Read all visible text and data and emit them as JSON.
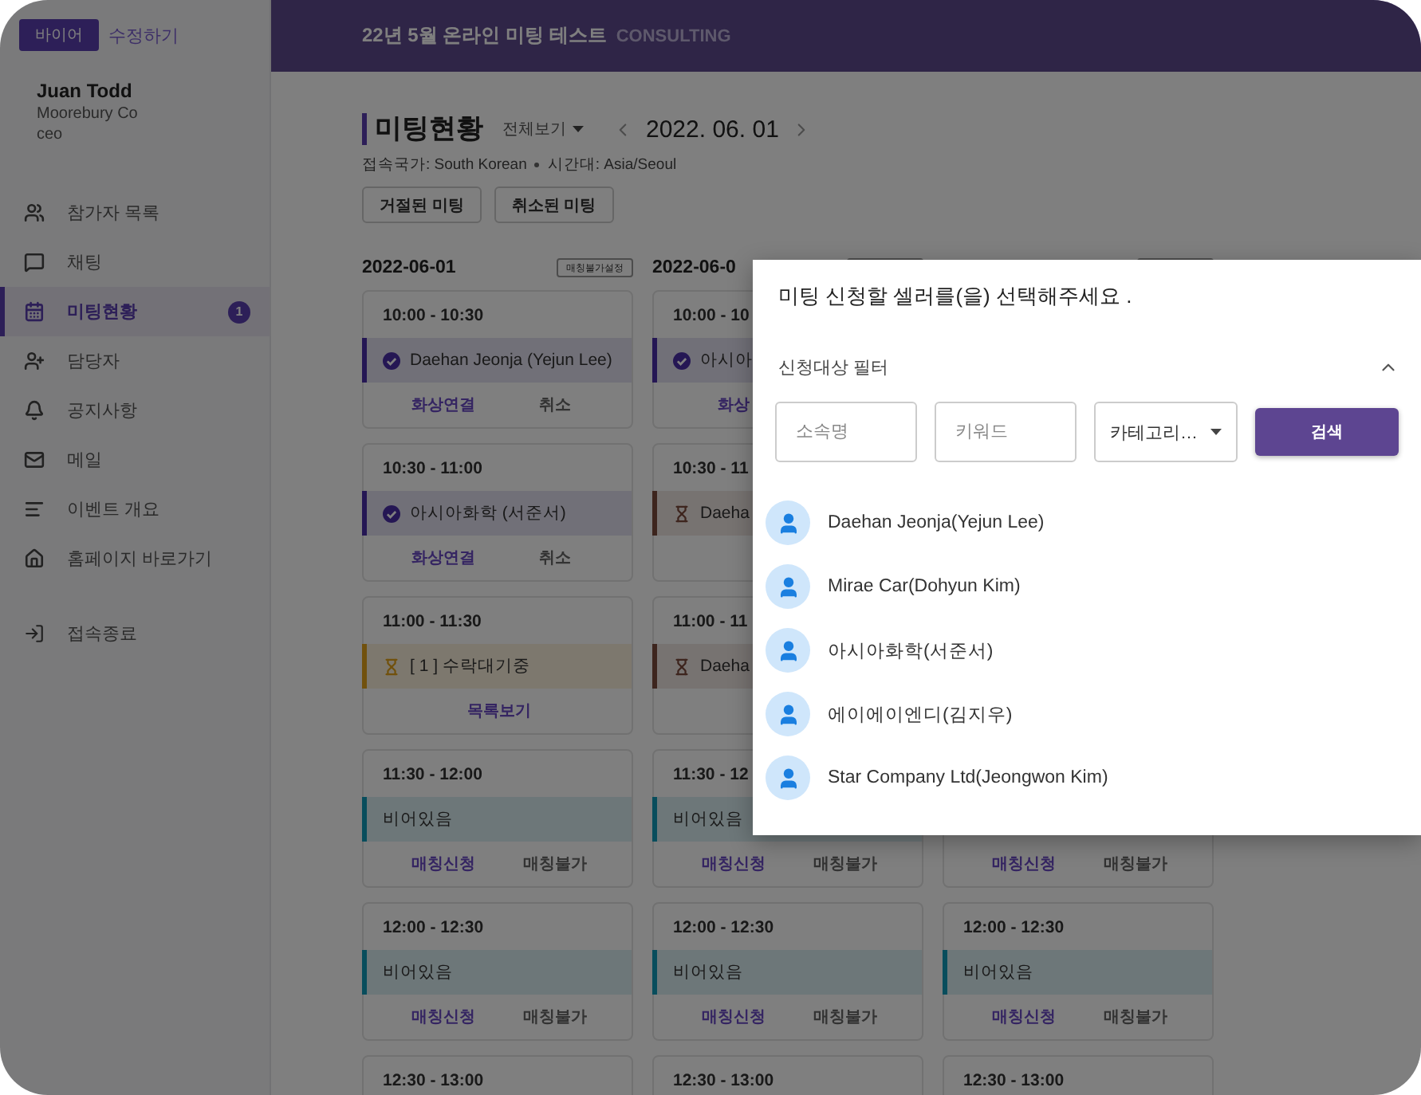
{
  "sidebar": {
    "role_badge": "바이어",
    "edit_link": "수정하기",
    "user": {
      "name": "Juan Todd",
      "company": "Moorebury Co",
      "position": "ceo"
    },
    "items": [
      {
        "label": "참가자 목록",
        "selected": false
      },
      {
        "label": "채팅",
        "selected": false
      },
      {
        "label": "미팅현황",
        "selected": true,
        "badge": "1"
      },
      {
        "label": "담당자",
        "selected": false
      },
      {
        "label": "공지사항",
        "selected": false
      },
      {
        "label": "메일",
        "selected": false
      },
      {
        "label": "이벤트 개요",
        "selected": false
      },
      {
        "label": "홈페이지 바로가기",
        "selected": false
      }
    ],
    "logout": "접속종료"
  },
  "header": {
    "title": "22년 5월 온라인 미팅 테스트",
    "subtitle": "CONSULTING"
  },
  "page": {
    "title": "미팅현황",
    "view_filter": "전체보기",
    "date": "2022. 06. 01",
    "country": "접속국가: South Korean",
    "timezone": "시간대: Asia/Seoul",
    "buttons": [
      "거절된 미팅",
      "취소된 미팅"
    ]
  },
  "columns": [
    {
      "date": "2022-06-01",
      "badge": "매칭불가설정",
      "slots": [
        {
          "time": "10:00 - 10:30",
          "kind": "confirmed",
          "label": "Daehan Jeonja (Yejun Lee)",
          "actions": [
            {
              "label": "화상연결",
              "kind": "primary"
            },
            {
              "label": "취소",
              "kind": "plain"
            }
          ]
        },
        {
          "time": "10:30 - 11:00",
          "kind": "confirmed",
          "label": "아시아화학 (서준서)",
          "actions": [
            {
              "label": "화상연결",
              "kind": "primary"
            },
            {
              "label": "취소",
              "kind": "plain"
            }
          ]
        },
        {
          "time": "11:00 - 11:30",
          "kind": "waiting",
          "label": "[ 1 ] 수락대기중",
          "actions": [
            {
              "label": "목록보기",
              "kind": "primary"
            }
          ]
        },
        {
          "time": "11:30 - 12:00",
          "kind": "empty",
          "label": "비어있음",
          "actions": [
            {
              "label": "매칭신청",
              "kind": "primary"
            },
            {
              "label": "매칭불가",
              "kind": "plain"
            }
          ]
        },
        {
          "time": "12:00 - 12:30",
          "kind": "empty",
          "label": "비어있음",
          "actions": [
            {
              "label": "매칭신청",
              "kind": "primary"
            },
            {
              "label": "매칭불가",
              "kind": "plain"
            }
          ]
        },
        {
          "time": "12:30 - 13:00",
          "kind": "empty"
        }
      ]
    },
    {
      "date": "2022-06-0",
      "slots": [
        {
          "time": "10:00 - 10",
          "kind": "confirmed",
          "label": "아시아",
          "actions": [
            {
              "label": "화상",
              "kind": "primary"
            }
          ]
        },
        {
          "time": "10:30 - 11",
          "kind": "requested",
          "label": "Daeha"
        },
        {
          "time": "11:00 - 11",
          "kind": "requested",
          "label": "Daeha"
        },
        {
          "time": "11:30 - 12",
          "kind": "empty",
          "label": "비어있음",
          "actions": [
            {
              "label": "매칭신청",
              "kind": "primary"
            },
            {
              "label": "매칭불가",
              "kind": "plain"
            }
          ]
        },
        {
          "time": "12:00 - 12:30",
          "kind": "empty",
          "label": "비어있음",
          "actions": [
            {
              "label": "매칭신청",
              "kind": "primary"
            },
            {
              "label": "매칭불가",
              "kind": "plain"
            }
          ]
        },
        {
          "time": "12:30 - 13:00",
          "kind": "empty"
        }
      ]
    },
    {
      "slots": [
        {
          "actions": [
            {
              "label": "매칭신청",
              "kind": "primary"
            },
            {
              "label": "매칭불가",
              "kind": "plain"
            }
          ]
        },
        {
          "time": "12:00 - 12:30",
          "kind": "empty",
          "label": "비어있음",
          "actions": [
            {
              "label": "매칭신청",
              "kind": "primary"
            },
            {
              "label": "매칭불가",
              "kind": "plain"
            }
          ]
        },
        {
          "time": "12:30 - 13:00",
          "kind": "empty"
        }
      ]
    }
  ],
  "modal": {
    "title": "미팅 신청할 셀러를(을) 선택해주세요 .",
    "filter": {
      "label": "신청대상 필터",
      "expanded": true,
      "fields": [
        {
          "placeholder": "소속명"
        },
        {
          "placeholder": "키워드"
        }
      ],
      "category": "카테고리…",
      "search_button": "검색"
    },
    "sellers": [
      "Daehan Jeonja(Yejun Lee)",
      "Mirae Car(Dohyun Kim)",
      "아시아화학(서준서)",
      "에이에이엔디(김지우)",
      "Star Company Ltd(Jeongwon Kim)"
    ]
  }
}
